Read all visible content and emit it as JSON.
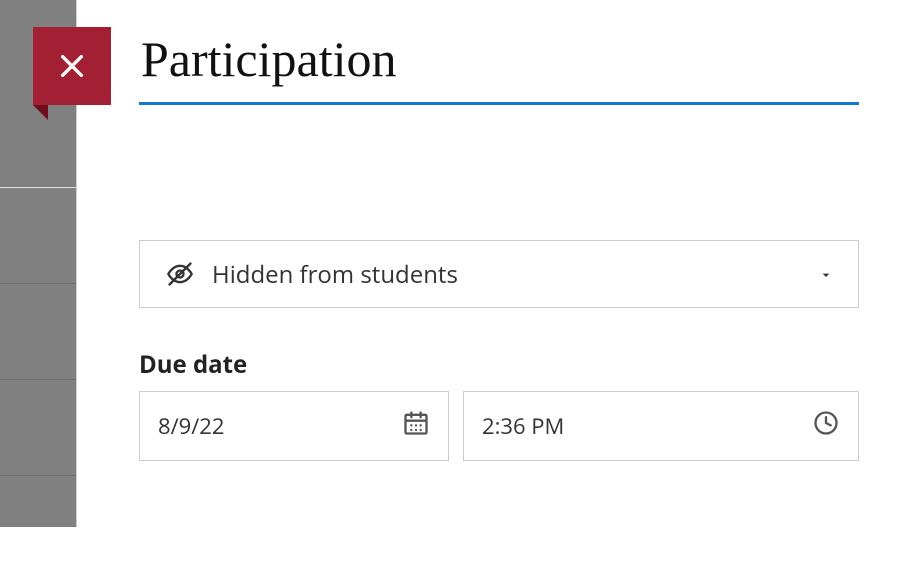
{
  "title": {
    "value": "Participation"
  },
  "visibility": {
    "label": "Hidden from students"
  },
  "due": {
    "label": "Due date",
    "date": "8/9/22",
    "time": "2:36 PM"
  }
}
